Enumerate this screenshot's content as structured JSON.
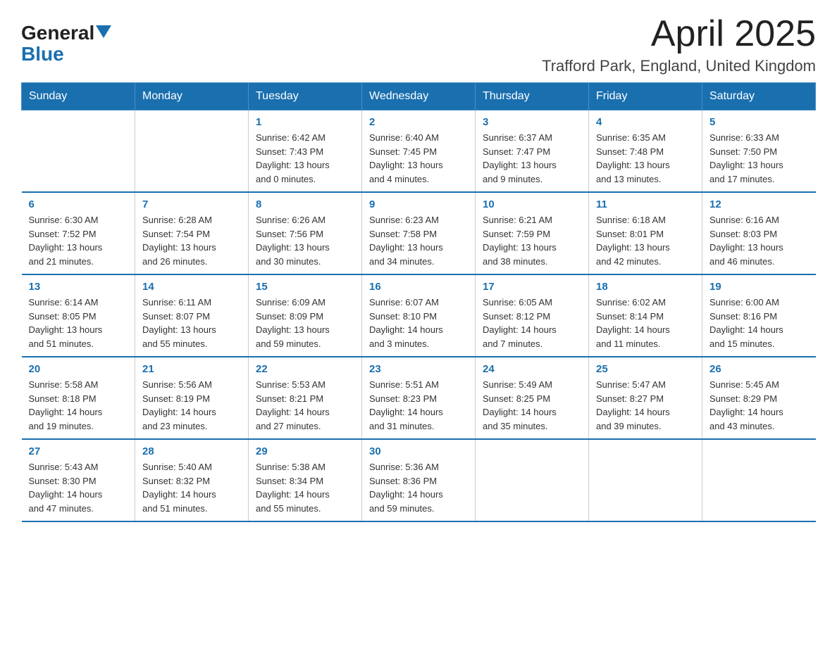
{
  "logo": {
    "general": "General",
    "blue": "Blue"
  },
  "title": "April 2025",
  "subtitle": "Trafford Park, England, United Kingdom",
  "weekdays": [
    "Sunday",
    "Monday",
    "Tuesday",
    "Wednesday",
    "Thursday",
    "Friday",
    "Saturday"
  ],
  "weeks": [
    [
      {
        "day": "",
        "info": ""
      },
      {
        "day": "",
        "info": ""
      },
      {
        "day": "1",
        "info": "Sunrise: 6:42 AM\nSunset: 7:43 PM\nDaylight: 13 hours\nand 0 minutes."
      },
      {
        "day": "2",
        "info": "Sunrise: 6:40 AM\nSunset: 7:45 PM\nDaylight: 13 hours\nand 4 minutes."
      },
      {
        "day": "3",
        "info": "Sunrise: 6:37 AM\nSunset: 7:47 PM\nDaylight: 13 hours\nand 9 minutes."
      },
      {
        "day": "4",
        "info": "Sunrise: 6:35 AM\nSunset: 7:48 PM\nDaylight: 13 hours\nand 13 minutes."
      },
      {
        "day": "5",
        "info": "Sunrise: 6:33 AM\nSunset: 7:50 PM\nDaylight: 13 hours\nand 17 minutes."
      }
    ],
    [
      {
        "day": "6",
        "info": "Sunrise: 6:30 AM\nSunset: 7:52 PM\nDaylight: 13 hours\nand 21 minutes."
      },
      {
        "day": "7",
        "info": "Sunrise: 6:28 AM\nSunset: 7:54 PM\nDaylight: 13 hours\nand 26 minutes."
      },
      {
        "day": "8",
        "info": "Sunrise: 6:26 AM\nSunset: 7:56 PM\nDaylight: 13 hours\nand 30 minutes."
      },
      {
        "day": "9",
        "info": "Sunrise: 6:23 AM\nSunset: 7:58 PM\nDaylight: 13 hours\nand 34 minutes."
      },
      {
        "day": "10",
        "info": "Sunrise: 6:21 AM\nSunset: 7:59 PM\nDaylight: 13 hours\nand 38 minutes."
      },
      {
        "day": "11",
        "info": "Sunrise: 6:18 AM\nSunset: 8:01 PM\nDaylight: 13 hours\nand 42 minutes."
      },
      {
        "day": "12",
        "info": "Sunrise: 6:16 AM\nSunset: 8:03 PM\nDaylight: 13 hours\nand 46 minutes."
      }
    ],
    [
      {
        "day": "13",
        "info": "Sunrise: 6:14 AM\nSunset: 8:05 PM\nDaylight: 13 hours\nand 51 minutes."
      },
      {
        "day": "14",
        "info": "Sunrise: 6:11 AM\nSunset: 8:07 PM\nDaylight: 13 hours\nand 55 minutes."
      },
      {
        "day": "15",
        "info": "Sunrise: 6:09 AM\nSunset: 8:09 PM\nDaylight: 13 hours\nand 59 minutes."
      },
      {
        "day": "16",
        "info": "Sunrise: 6:07 AM\nSunset: 8:10 PM\nDaylight: 14 hours\nand 3 minutes."
      },
      {
        "day": "17",
        "info": "Sunrise: 6:05 AM\nSunset: 8:12 PM\nDaylight: 14 hours\nand 7 minutes."
      },
      {
        "day": "18",
        "info": "Sunrise: 6:02 AM\nSunset: 8:14 PM\nDaylight: 14 hours\nand 11 minutes."
      },
      {
        "day": "19",
        "info": "Sunrise: 6:00 AM\nSunset: 8:16 PM\nDaylight: 14 hours\nand 15 minutes."
      }
    ],
    [
      {
        "day": "20",
        "info": "Sunrise: 5:58 AM\nSunset: 8:18 PM\nDaylight: 14 hours\nand 19 minutes."
      },
      {
        "day": "21",
        "info": "Sunrise: 5:56 AM\nSunset: 8:19 PM\nDaylight: 14 hours\nand 23 minutes."
      },
      {
        "day": "22",
        "info": "Sunrise: 5:53 AM\nSunset: 8:21 PM\nDaylight: 14 hours\nand 27 minutes."
      },
      {
        "day": "23",
        "info": "Sunrise: 5:51 AM\nSunset: 8:23 PM\nDaylight: 14 hours\nand 31 minutes."
      },
      {
        "day": "24",
        "info": "Sunrise: 5:49 AM\nSunset: 8:25 PM\nDaylight: 14 hours\nand 35 minutes."
      },
      {
        "day": "25",
        "info": "Sunrise: 5:47 AM\nSunset: 8:27 PM\nDaylight: 14 hours\nand 39 minutes."
      },
      {
        "day": "26",
        "info": "Sunrise: 5:45 AM\nSunset: 8:29 PM\nDaylight: 14 hours\nand 43 minutes."
      }
    ],
    [
      {
        "day": "27",
        "info": "Sunrise: 5:43 AM\nSunset: 8:30 PM\nDaylight: 14 hours\nand 47 minutes."
      },
      {
        "day": "28",
        "info": "Sunrise: 5:40 AM\nSunset: 8:32 PM\nDaylight: 14 hours\nand 51 minutes."
      },
      {
        "day": "29",
        "info": "Sunrise: 5:38 AM\nSunset: 8:34 PM\nDaylight: 14 hours\nand 55 minutes."
      },
      {
        "day": "30",
        "info": "Sunrise: 5:36 AM\nSunset: 8:36 PM\nDaylight: 14 hours\nand 59 minutes."
      },
      {
        "day": "",
        "info": ""
      },
      {
        "day": "",
        "info": ""
      },
      {
        "day": "",
        "info": ""
      }
    ]
  ]
}
